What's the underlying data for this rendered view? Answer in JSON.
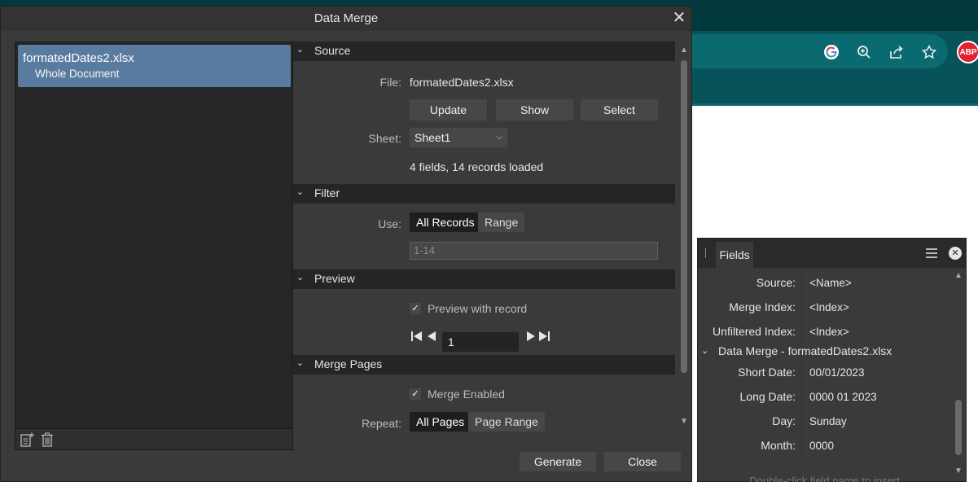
{
  "dialog": {
    "title": "Data Merge",
    "close_symbol": "✕",
    "documents": [
      {
        "name": "formatedDates2.xlsx",
        "sub": "Whole Document"
      }
    ]
  },
  "source": {
    "header": "Source",
    "file_label": "File:",
    "file_value": "formatedDates2.xlsx",
    "update_label": "Update",
    "show_label": "Show",
    "select_label": "Select",
    "sheet_label": "Sheet:",
    "sheet_value": "Sheet1",
    "status": "4 fields, 14 records loaded"
  },
  "filter": {
    "header": "Filter",
    "use_label": "Use:",
    "opt_all": "All Records",
    "opt_range": "Range",
    "range_placeholder": "1-14"
  },
  "preview": {
    "header": "Preview",
    "checkbox_label": "Preview with record",
    "checked": true,
    "record": "1"
  },
  "merge_pages": {
    "header": "Merge Pages",
    "checkbox_label": "Merge Enabled",
    "checked": true,
    "repeat_label": "Repeat:",
    "opt_all": "All Pages",
    "opt_range": "Page Range"
  },
  "actions": {
    "generate_label": "Generate",
    "close_label": "Close"
  },
  "fields_panel": {
    "tab_label": "Fields",
    "rows": [
      {
        "label": "Source:",
        "value": "<Name>"
      },
      {
        "label": "Merge Index:",
        "value": "<Index>"
      },
      {
        "label": "Unfiltered Index:",
        "value": "<Index>"
      }
    ],
    "group_title": "Data Merge - formatedDates2.xlsx",
    "group_rows": [
      {
        "label": "Short Date:",
        "value": "00/01/2023"
      },
      {
        "label": "Long Date:",
        "value": "0000 01 2023"
      },
      {
        "label": "Day:",
        "value": "Sunday"
      },
      {
        "label": "Month:",
        "value": "0000"
      }
    ],
    "hint": "Double-click field name to insert"
  },
  "browser": {
    "adblock_badge": "ABP",
    "icons": [
      "google-icon",
      "zoom-icon",
      "share-icon",
      "bookmark-star-icon",
      "adblock-icon"
    ]
  }
}
